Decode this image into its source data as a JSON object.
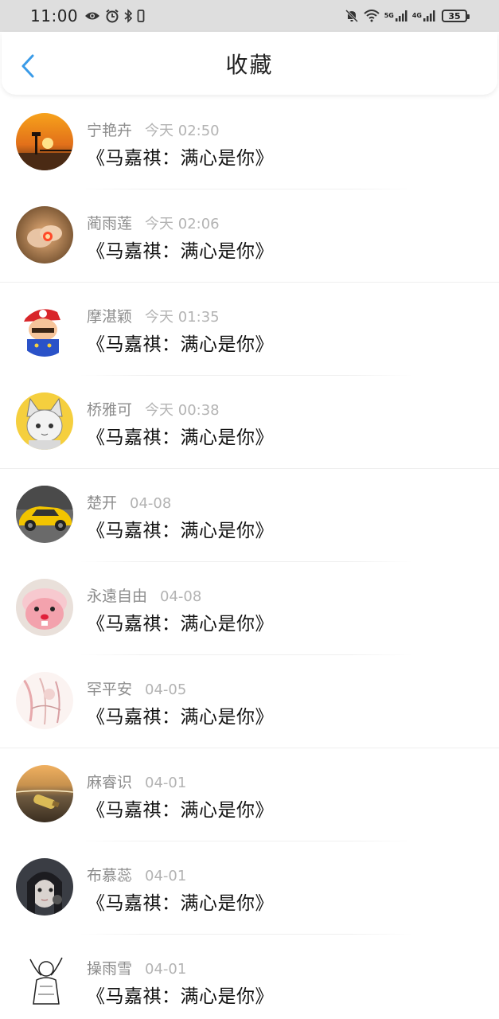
{
  "status_bar": {
    "time": "11:00",
    "network_5g": "5G",
    "network_4g": "4G",
    "battery": "35"
  },
  "header": {
    "title": "收藏",
    "back_icon": "chevron-left-icon",
    "accent_color": "#3a9be8"
  },
  "items": [
    {
      "user": "宁艳卉",
      "time": "今天 02:50",
      "title": "《马嘉祺：满心是你》",
      "avatar": "sunset-photo"
    },
    {
      "user": "蔺雨莲",
      "time": "今天 02:06",
      "title": "《马嘉祺：满心是你》",
      "avatar": "hands-glow-photo"
    },
    {
      "user": "摩湛颖",
      "time": "今天 01:35",
      "title": "《马嘉祺：满心是你》",
      "avatar": "mario-cartoon"
    },
    {
      "user": "桥雅可",
      "time": "今天 00:38",
      "title": "《马嘉祺：满心是你》",
      "avatar": "anime-catgirl"
    },
    {
      "user": "楚开",
      "time": "04-08",
      "title": "《马嘉祺：满心是你》",
      "avatar": "yellow-car"
    },
    {
      "user": "永遠自由",
      "time": "04-08",
      "title": "《马嘉祺：满心是你》",
      "avatar": "pink-beaver"
    },
    {
      "user": "罕平安",
      "time": "04-05",
      "title": "《马嘉祺：满心是你》",
      "avatar": "pink-sketch"
    },
    {
      "user": "麻睿识",
      "time": "04-01",
      "title": "《马嘉祺：满心是你》",
      "avatar": "beach-bottle"
    },
    {
      "user": "布慕蕊",
      "time": "04-01",
      "title": "《马嘉祺：满心是你》",
      "avatar": "dark-girl"
    },
    {
      "user": "操雨雪",
      "time": "04-01",
      "title": "《马嘉祺：满心是你》",
      "avatar": "line-drawing"
    }
  ]
}
